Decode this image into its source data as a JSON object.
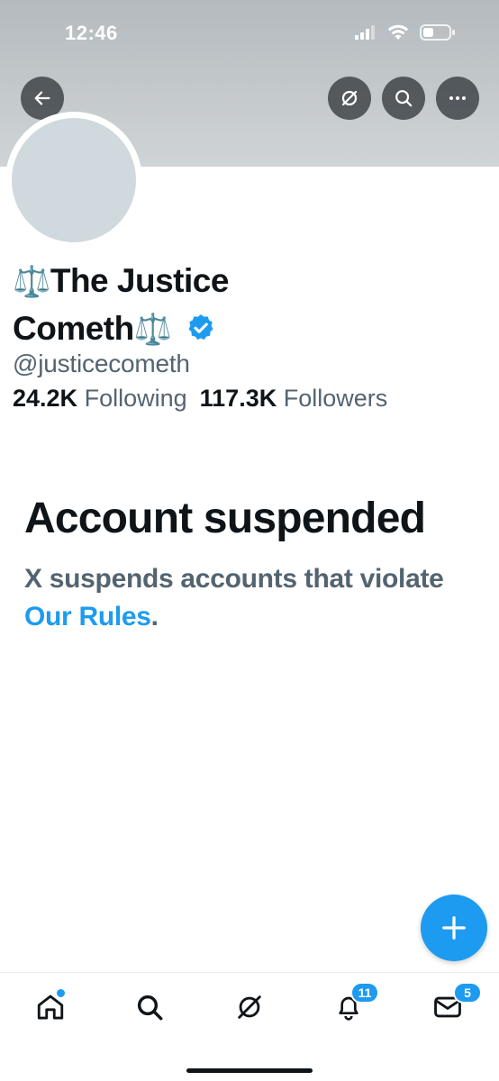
{
  "status_bar": {
    "time": "12:46"
  },
  "header": {
    "back_icon": "arrow-left-icon",
    "grok_icon": "grok-icon",
    "search_icon": "search-icon",
    "more_icon": "more-horizontal-icon"
  },
  "profile": {
    "name_line1": "The Justice",
    "name_line2": "Cometh",
    "name_emoji": "⚖️",
    "verified": true,
    "handle": "@justicecometh",
    "following_count": "24.2K",
    "following_label": "Following",
    "followers_count": "117.3K",
    "followers_label": "Followers"
  },
  "suspension": {
    "title": "Account suspended",
    "desc_part1": "X suspends accounts that violate",
    "link_text": "Our Rules",
    "desc_end": "."
  },
  "tabbar": {
    "items": [
      {
        "name": "home",
        "icon": "home-icon"
      },
      {
        "name": "search",
        "icon": "search-icon"
      },
      {
        "name": "grok",
        "icon": "grok-icon"
      },
      {
        "name": "notifications",
        "icon": "bell-icon",
        "badge": "11"
      },
      {
        "name": "messages",
        "icon": "mail-icon",
        "badge": "5"
      }
    ]
  },
  "colors": {
    "accent": "#1d9bf0",
    "text": "#0f1419",
    "secondary": "#536471",
    "banner": "#c5cacd"
  }
}
